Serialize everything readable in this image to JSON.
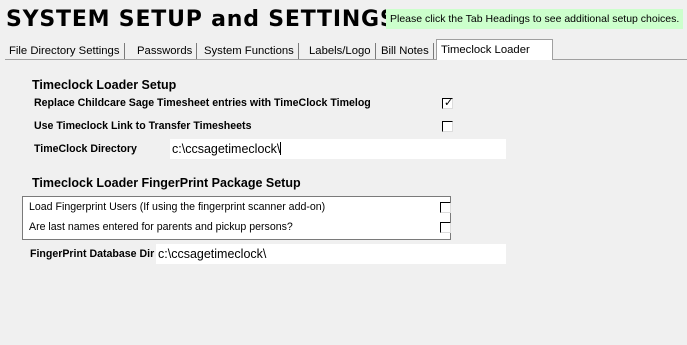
{
  "page_title": "SYSTEM SETUP and SETTINGS",
  "hint_text": "Please click the Tab Headings to see additional setup choices.",
  "tabs": [
    {
      "label": "File Directory Settings",
      "active": false
    },
    {
      "label": "Passwords",
      "active": false
    },
    {
      "label": "System Functions",
      "active": false
    },
    {
      "label": "Labels/Logo",
      "active": false
    },
    {
      "label": "Bill Notes",
      "active": false
    },
    {
      "label": "Timeclock Loader",
      "active": true
    }
  ],
  "timeclock_section": {
    "heading": "Timeclock Loader Setup",
    "replace_entries": {
      "label": "Replace Childcare Sage Timesheet entries with TimeClock Timelog",
      "checked": true
    },
    "use_link": {
      "label": "Use Timeclock Link to Transfer Timesheets",
      "checked": false
    },
    "directory": {
      "label": "TimeClock Directory",
      "value": "c:\\ccsagetimeclock\\"
    }
  },
  "fingerprint_section": {
    "heading": "Timeclock Loader FingerPrint Package Setup",
    "load_users": {
      "label": "Load Fingerprint Users (If using the fingerprint scanner add-on)",
      "checked": false
    },
    "last_names": {
      "label": "Are last names entered for parents and pickup persons?",
      "checked": false
    },
    "database_dir": {
      "label": "FingerPrint Database Dir",
      "value": "c:\\ccsagetimeclock\\"
    }
  },
  "colors": {
    "hint_background": "#ccffcc",
    "panel_background": "#f0f0f0"
  }
}
